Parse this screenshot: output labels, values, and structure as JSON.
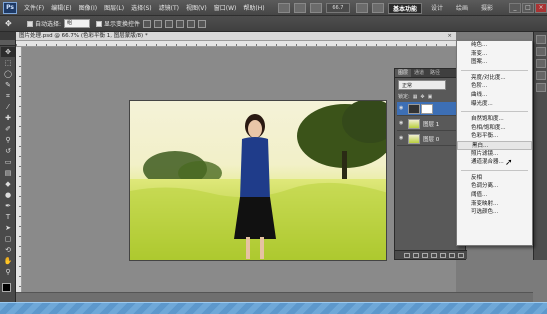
{
  "app": {
    "logo": "Ps",
    "menu": [
      "文件(F)",
      "编辑(E)",
      "图像(I)",
      "图层(L)",
      "选择(S)",
      "滤镜(T)",
      "视图(V)",
      "窗口(W)",
      "帮助(H)"
    ],
    "zoom": "66.7",
    "workspaces": [
      "基本功能",
      "设计",
      "绘画",
      "摄影"
    ],
    "active_workspace": "基本功能",
    "window_controls": [
      "_",
      "□",
      "×"
    ]
  },
  "options": {
    "tool_icon": "move-icon",
    "auto_select_label": "自动选择:",
    "auto_select_value": "组",
    "show_transform_label": "显示变换控件"
  },
  "document": {
    "tab_title": "图片处理.psd @ 66.7% (色彩平衡 1, 图层蒙版/8) *",
    "close": "×"
  },
  "layers_panel": {
    "tabs": [
      "图层",
      "通道",
      "路径"
    ],
    "blend_mode": "正常",
    "lock_label": "锁定:",
    "layers": [
      {
        "name": "",
        "kind": "adjustment",
        "active": true
      },
      {
        "name": "图层 1",
        "kind": "photo",
        "active": false
      },
      {
        "name": "图层 0",
        "kind": "photo",
        "active": false
      }
    ]
  },
  "adjustment_menu": {
    "groups": [
      [
        "纯色...",
        "渐变...",
        "图案..."
      ],
      [
        "亮度/对比度...",
        "色阶...",
        "曲线...",
        "曝光度..."
      ],
      [
        "自然饱和度...",
        "色相/饱和度...",
        "色彩平衡...",
        "黑白...",
        "照片滤镜...",
        "通道混合器..."
      ],
      [
        "反相",
        "色调分离...",
        "阈值...",
        "渐变映射...",
        "可选颜色..."
      ]
    ],
    "hovered": "黑白..."
  },
  "colors": {
    "accent": "#3d6fb5",
    "menu_bg": "#f4f4f4",
    "app_bg": "#7b7b7b",
    "taskbar": "#6fa8d8"
  }
}
